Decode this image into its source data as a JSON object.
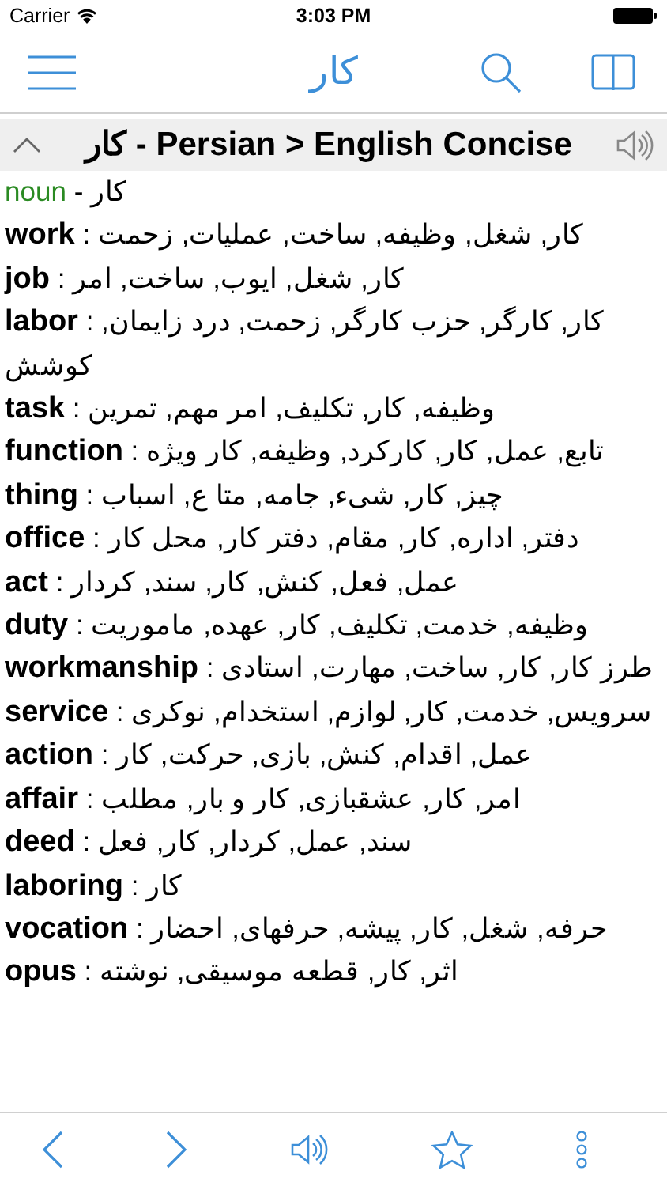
{
  "status_bar": {
    "carrier": "Carrier",
    "time": "3:03 PM"
  },
  "nav_bar": {
    "title": "کار"
  },
  "section": {
    "title": "کار - Persian > English Concise",
    "expanded": true
  },
  "entry": {
    "part_of_speech": "noun",
    "headword": "- کار",
    "senses": [
      "**work** : کار, شغل, وظیفه, ساخت, عملیات, زحمت",
      "**job** : کار, شغل, ایوب, ساخت, امر",
      "**labor** : کار, کارگر, حزب کارگر, زحمت, درد زایمان, کوشش",
      "**task** : وظیفه, کار, تکلیف, امر مهم, تمرین",
      "**function** : تابع, عمل, کار, کارکرد, وظیفه, کار ویژه",
      "**thing** : چیز, کار, شیء, جامه, متا ع, اسباب",
      "**office** : دفتر, اداره, کار, مقام, دفتر کار, محل کار",
      "**act** : عمل, فعل, کنش, کار, سند, کردار",
      "**duty** : وظیفه, خدمت, تکلیف, کار, عهده, ماموریت",
      "**workmanship** : طرز کار, کار, ساخت, مهارت, استادی",
      "**service** : سرویس, خدمت, کار, لوازم, استخدام, نوکری",
      "**action** : عمل, اقدام, کنش, بازی, حرکت, کار",
      "**affair** : امر, کار, عشقبازی, کار و بار, مطلب",
      "**deed** : سند, عمل, کردار, کار, فعل",
      "**laboring** : کار",
      "**vocation** : حرفه, شغل, کار, پیشه, حرفهای, احضار",
      "**opus** : اثر, کار, قطعه موسیقی, نوشته"
    ]
  }
}
